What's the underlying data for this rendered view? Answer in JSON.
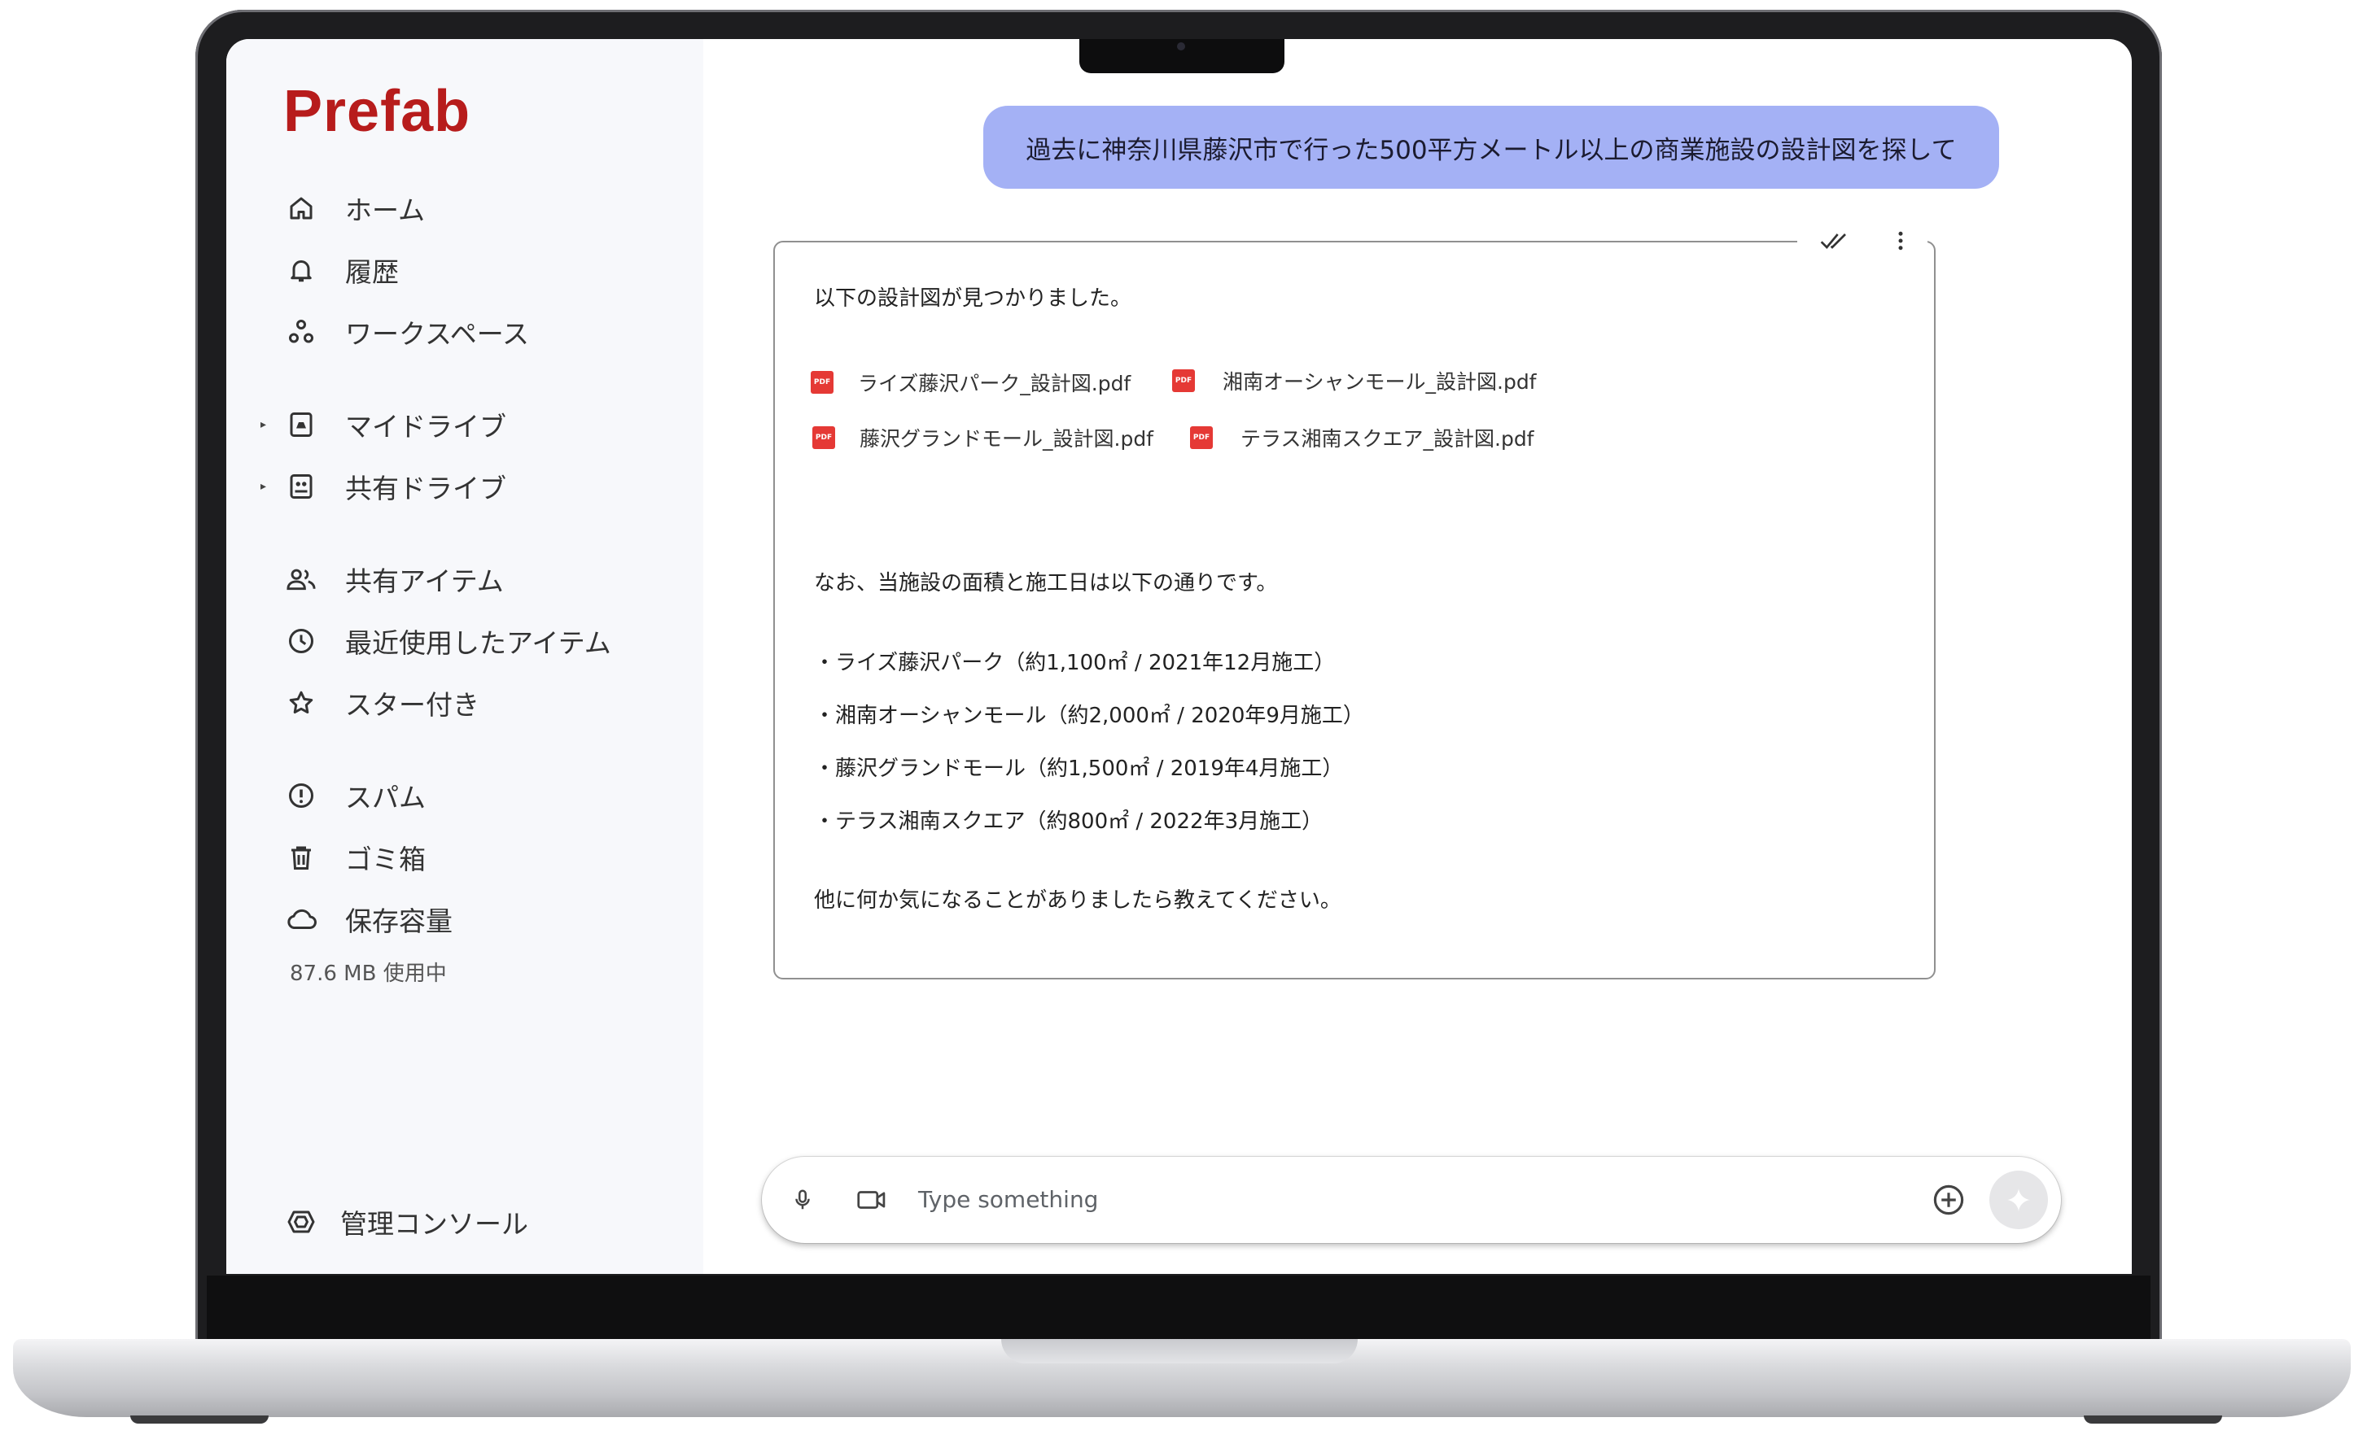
{
  "app": {
    "logo": "Prefab"
  },
  "sidebar": {
    "items": [
      {
        "label": "ホーム",
        "icon": "home-icon"
      },
      {
        "label": "履歴",
        "icon": "bell-icon"
      },
      {
        "label": "ワークスペース",
        "icon": "workspace-icon"
      },
      {
        "label": "マイドライブ",
        "icon": "my-drive-icon"
      },
      {
        "label": "共有ドライブ",
        "icon": "shared-drive-icon"
      },
      {
        "label": "共有アイテム",
        "icon": "people-icon"
      },
      {
        "label": "最近使用したアイテム",
        "icon": "clock-icon"
      },
      {
        "label": "スター付き",
        "icon": "star-icon"
      },
      {
        "label": "スパム",
        "icon": "alert-icon"
      },
      {
        "label": "ゴミ箱",
        "icon": "trash-icon"
      },
      {
        "label": "保存容量",
        "icon": "cloud-icon"
      }
    ],
    "storage_used": "87.6 MB 使用中",
    "admin_console": "管理コンソール"
  },
  "chat": {
    "user_message": "過去に神奈川県藤沢市で行った500平方メートル以上の商業施設の設計図を探して",
    "response": {
      "intro": "以下の設計図が見つかりました。",
      "files": [
        "ライズ藤沢パーク_設計図.pdf",
        "湘南オーシャンモール_設計図.pdf",
        "藤沢グランドモール_設計図.pdf",
        "テラス湘南スクエア_設計図.pdf"
      ],
      "note": "なお、当施設の面積と施工日は以下の通りです。",
      "details": [
        "・ライズ藤沢パーク（約1,100㎡ / 2021年12月施工）",
        "・湘南オーシャンモール（約2,000㎡ / 2020年9月施工）",
        "・藤沢グランドモール（約1,500㎡ / 2019年4月施工）",
        "・テラス湘南スクエア（約800㎡ / 2022年3月施工）"
      ],
      "closing": "他に何か気になることがありましたら教えてください。"
    }
  },
  "input": {
    "placeholder": "Type something"
  },
  "colors": {
    "brand": "#b71c1c",
    "user_bubble": "#a4b1f5",
    "pdf": "#e53935"
  }
}
